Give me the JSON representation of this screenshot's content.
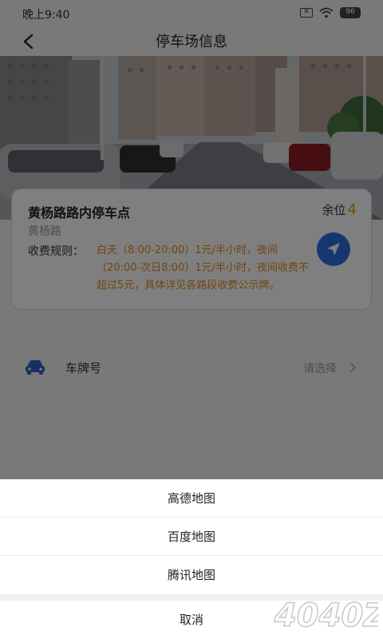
{
  "status_bar": {
    "time": "晚上9:40",
    "battery": "96",
    "icons": [
      "notification-x-icon",
      "wifi-icon",
      "battery-icon"
    ]
  },
  "nav": {
    "title": "停车场信息",
    "back_icon": "back-arrow-icon"
  },
  "lot": {
    "name": "黄杨路路内停车点",
    "spots_label": "余位",
    "spots_count": "4",
    "address": "黄杨路",
    "fee_label": "收费规则：",
    "fee_rules": "白天（8:00-20:00）1元/半小时，夜间（20:00-次日8:00）1元/半小时，夜间收费不超过5元，具体详见各路段收费公示牌。",
    "navigate_icon": "navigation-arrow-icon"
  },
  "plate": {
    "label": "车牌号",
    "placeholder": "请选择",
    "icon": "car-icon"
  },
  "sheet": {
    "options": [
      "高德地图",
      "百度地图",
      "腾讯地图"
    ],
    "cancel": "取消"
  },
  "watermark": "4040Z",
  "colors": {
    "accent_orange": "#e6961c",
    "nav_blue": "#2f6de1",
    "car_blue": "#2f5fc7"
  }
}
